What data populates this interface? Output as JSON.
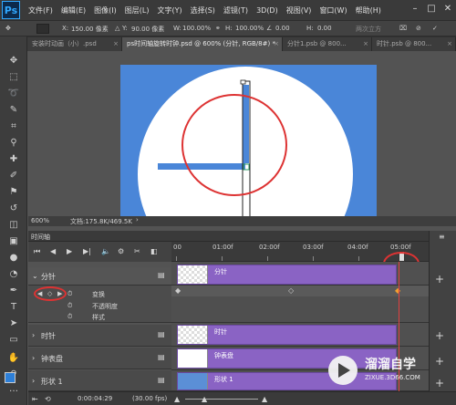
{
  "app": {
    "logo": "Ps"
  },
  "menu": [
    "文件(F)",
    "编辑(E)",
    "图像(I)",
    "图层(L)",
    "文字(Y)",
    "选择(S)",
    "滤镜(T)",
    "3D(D)",
    "视图(V)",
    "窗口(W)",
    "帮助(H)"
  ],
  "options": {
    "x_label": "X:",
    "x_value": "150.00 像素",
    "y_label": "Y:",
    "y_value": "90.00 像素",
    "w_label": "W:",
    "w_value": "100.00%",
    "h_label": "H:",
    "h_value": "100.00%",
    "angle_value": "0.00",
    "h2_label": "H:",
    "h2_value": "0.00",
    "interp": "两次立方",
    "v2": "0.00"
  },
  "tabs": [
    "安装时动画（小）.psd",
    "ps时间轴旋转时钟.psd @ 600% (分针, RGB/8#) *",
    "分针1.psb @ 800...",
    "时针.psb @ 800..."
  ],
  "status": {
    "zoom": "600%",
    "doc": "文档:175.8K/469.5K"
  },
  "timeline": {
    "title": "时间轴",
    "ruler": [
      "00",
      "01:00f",
      "02:00f",
      "03:00f",
      "04:00f",
      "05:00f"
    ],
    "layers": [
      {
        "name": "分针",
        "clip": "分针"
      },
      {
        "name": "时针",
        "clip": "时针"
      },
      {
        "name": "钟表盘",
        "clip": "钟表盘"
      },
      {
        "name": "形状 1",
        "clip": "形状 1"
      }
    ],
    "props": [
      "变换",
      "不透明度",
      "样式"
    ],
    "footer_time": "0:00:04:29",
    "footer_fps": "(30.00 fps)"
  },
  "watermark": {
    "title": "溜溜自学",
    "url": "ZIXUE.3D66.COM"
  },
  "colors": {
    "canvas_bg": "#4a86d8",
    "clip": "#8a63c4",
    "highlight": "#d33333",
    "accent_tab": "#535353"
  }
}
